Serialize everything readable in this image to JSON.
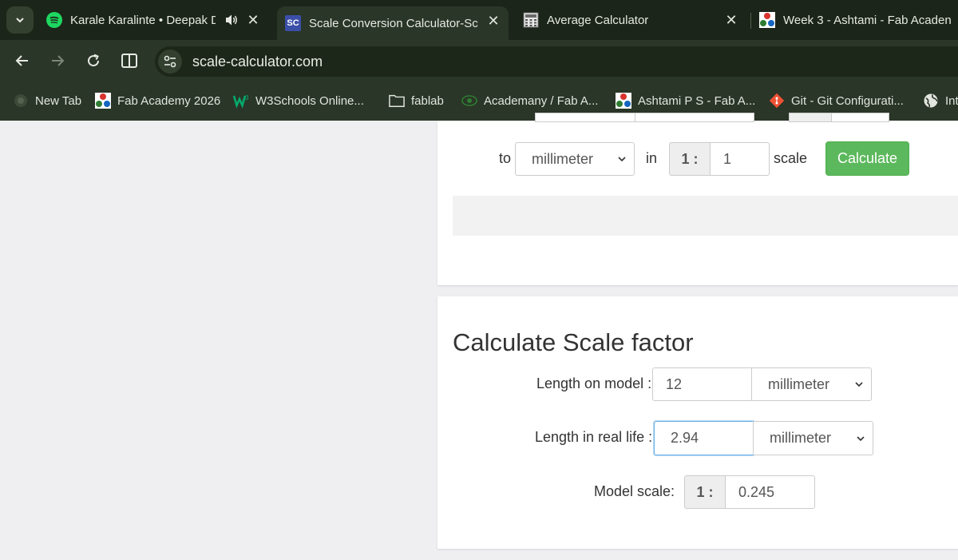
{
  "browser": {
    "tabs": [
      {
        "title": "Karale Karalinte • Deepak D",
        "icon": "spotify-icon",
        "active": false
      },
      {
        "title": "Scale Conversion Calculator-Sca",
        "icon": "sc-favicon",
        "active": true
      },
      {
        "title": "Average Calculator",
        "icon": "calculator-icon",
        "active": false
      },
      {
        "title": "Week 3 - Ashtami - Fab Acaden",
        "icon": "fab-academy-icon",
        "active": false
      }
    ],
    "favicon_text": "SC",
    "url": "scale-calculator.com",
    "bookmarks": [
      {
        "label": "New Tab",
        "icon": "new-tab-icon"
      },
      {
        "label": "Fab Academy 2026",
        "icon": "fab-academy-icon"
      },
      {
        "label": "W3Schools Online...",
        "icon": "w3schools-icon"
      },
      {
        "label": "fablab",
        "icon": "folder-icon"
      },
      {
        "label": "Academany / Fab A...",
        "icon": "academany-icon"
      },
      {
        "label": "Ashtami P S - Fab A...",
        "icon": "fab-academy-icon"
      },
      {
        "label": "Git - Git Configurati...",
        "icon": "git-icon"
      },
      {
        "label": "Int",
        "icon": "globe-icon"
      }
    ]
  },
  "converter": {
    "to_label": "to",
    "to_unit": "millimeter",
    "in_label": "in",
    "scale_prefix": "1 :",
    "scale_value": "1",
    "scale_label": "scale",
    "calculate_label": "Calculate"
  },
  "scale_factor": {
    "heading": "Calculate Scale factor",
    "model_length_label": "Length on model :",
    "model_length_value": "12",
    "model_unit": "millimeter",
    "real_length_label": "Length in real life :",
    "real_length_value": "2.94",
    "real_unit": "millimeter",
    "model_scale_label": "Model scale:",
    "model_scale_prefix": "1 :",
    "model_scale_value": "0.245"
  },
  "colors": {
    "chrome_bg": "#2a3627",
    "calculate_button": "#5cb85c",
    "focused_border": "#66afe9"
  }
}
